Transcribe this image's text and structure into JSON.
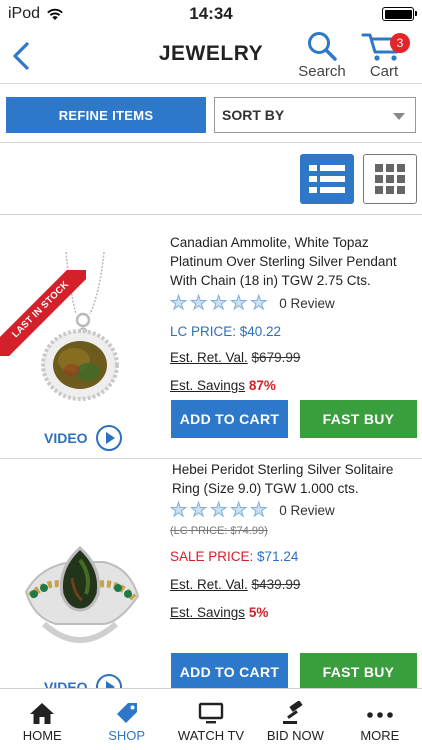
{
  "status_bar": {
    "carrier": "iPod",
    "time": "14:34"
  },
  "header": {
    "title": "JEWELRY",
    "search_label": "Search",
    "cart_label": "Cart",
    "cart_count": "3"
  },
  "filters": {
    "refine_label": "REFINE ITEMS",
    "sort_label": "SORT BY"
  },
  "colors": {
    "accent": "#2d78c8",
    "buy": "#3a9d3e",
    "sale": "#d3202a"
  },
  "products": [
    {
      "badge": "LAST IN STOCK",
      "title": "Canadian Ammolite, White Topaz Platinum Over Sterling Silver Pendant With Chain (18 in) TGW 2.75 Cts.",
      "review_count": "0 Review",
      "rating": 0,
      "lc_price": "LC PRICE: $40.22",
      "est_ret_label": "Est. Ret. Val.",
      "est_ret_value": "$679.99",
      "est_savings_label": "Est. Savings",
      "est_savings_value": "87%",
      "video_label": "VIDEO",
      "add_to_cart": "ADD TO CART",
      "fast_buy": "FAST BUY"
    },
    {
      "title": "Hebei Peridot Sterling Silver Solitaire Ring (Size 9.0) TGW 1.000 cts.",
      "review_count": "0 Review",
      "rating": 0,
      "old_lc_price": "(LC PRICE: $74.99)",
      "sale_label": "SALE PRICE:",
      "sale_value": "$71.24",
      "est_ret_label": "Est. Ret. Val.",
      "est_ret_value": "$439.99",
      "est_savings_label": "Est. Savings",
      "est_savings_value": "5%",
      "video_label": "VIDEO",
      "add_to_cart": "ADD TO CART",
      "fast_buy": "FAST BUY"
    }
  ],
  "tabs": [
    {
      "label": "HOME",
      "icon": "home-icon"
    },
    {
      "label": "SHOP",
      "icon": "tag-icon",
      "active": true
    },
    {
      "label": "WATCH TV",
      "icon": "tv-icon"
    },
    {
      "label": "BID NOW",
      "icon": "gavel-icon"
    },
    {
      "label": "MORE",
      "icon": "more-dots-icon"
    }
  ]
}
